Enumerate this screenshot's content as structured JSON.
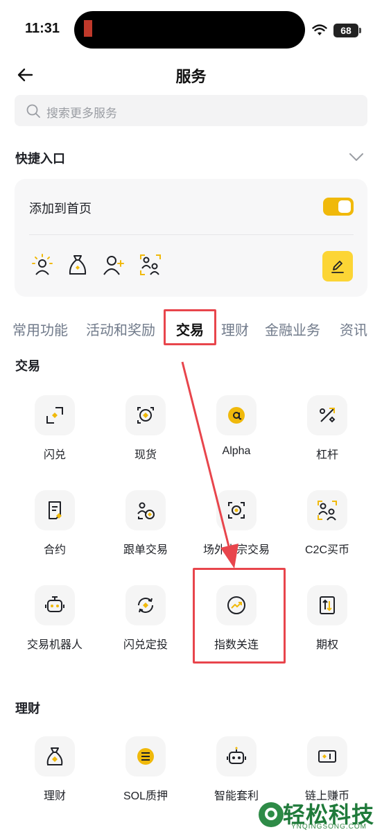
{
  "status_bar": {
    "time": "11:31",
    "battery": "68"
  },
  "header": {
    "title": "服务"
  },
  "search": {
    "placeholder": "搜索更多服务"
  },
  "quick_access": {
    "title": "快捷入口",
    "add_to_home_label": "添加到首页",
    "toggle_on": true,
    "icons": [
      "referral-icon",
      "wallet-bag-icon",
      "add-friend-icon",
      "c2c-icon"
    ]
  },
  "tabs": [
    {
      "label": "常用功能",
      "active": false
    },
    {
      "label": "活动和奖励",
      "active": false
    },
    {
      "label": "交易",
      "active": true
    },
    {
      "label": "理财",
      "active": false
    },
    {
      "label": "金融业务",
      "active": false
    },
    {
      "label": "资讯",
      "active": false
    }
  ],
  "sections": {
    "trade": {
      "title": "交易",
      "items": [
        {
          "label": "闪兑",
          "icon": "convert-icon"
        },
        {
          "label": "现货",
          "icon": "spot-icon"
        },
        {
          "label": "Alpha",
          "icon": "alpha-icon"
        },
        {
          "label": "杠杆",
          "icon": "margin-icon"
        },
        {
          "label": "合约",
          "icon": "futures-icon"
        },
        {
          "label": "跟单交易",
          "icon": "copy-trading-icon"
        },
        {
          "label": "场外大宗交易",
          "icon": "otc-icon"
        },
        {
          "label": "C2C买币",
          "icon": "c2c-icon"
        },
        {
          "label": "交易机器人",
          "icon": "bot-icon"
        },
        {
          "label": "闪兑定投",
          "icon": "recurring-icon"
        },
        {
          "label": "指数关连",
          "icon": "index-link-icon"
        },
        {
          "label": "期权",
          "icon": "options-icon"
        }
      ]
    },
    "earn": {
      "title": "理财",
      "items": [
        {
          "label": "理财",
          "icon": "earn-bag-icon"
        },
        {
          "label": "SOL质押",
          "icon": "sol-staking-icon"
        },
        {
          "label": "智能套利",
          "icon": "arbitrage-bot-icon"
        },
        {
          "label": "链上赚币",
          "icon": "onchain-earn-icon"
        }
      ]
    }
  },
  "colors": {
    "accent": "#fcd535",
    "toggle": "#f0b90b",
    "annotation": "#e8454c",
    "text": "#1e2026",
    "muted": "#707a8a"
  },
  "watermark": {
    "text": "轻松科技",
    "sub": "YNQINGSONG.COM"
  }
}
